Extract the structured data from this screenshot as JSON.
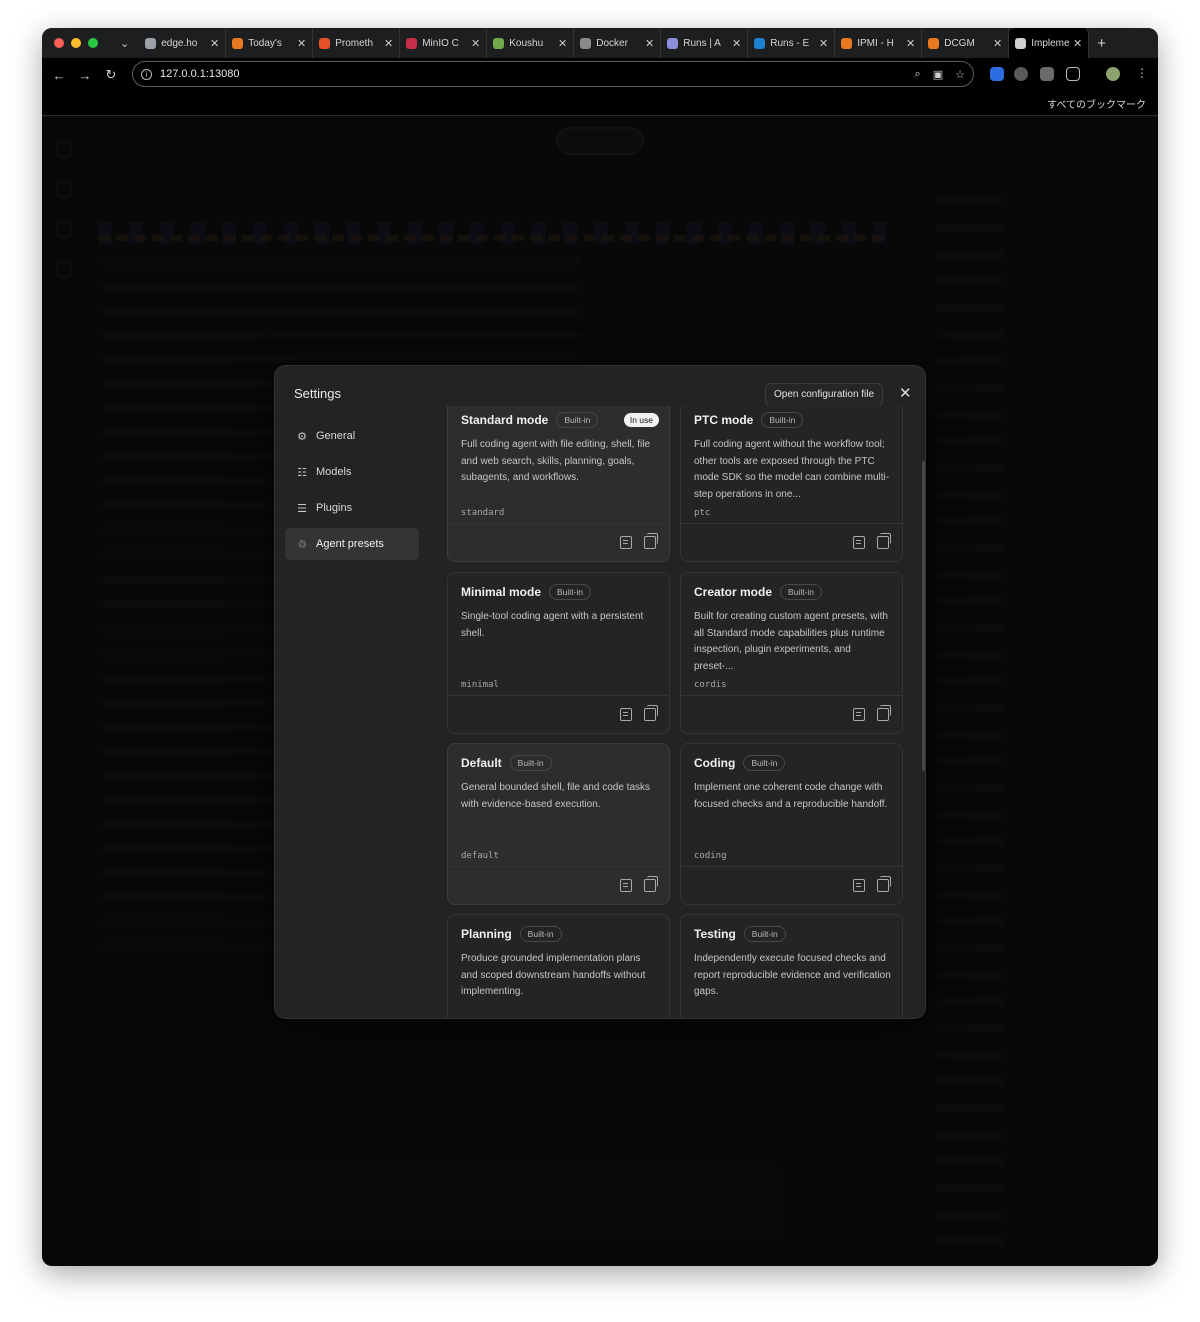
{
  "browser": {
    "tabs": [
      {
        "label": "edge.ho",
        "color": "#9aa0a6"
      },
      {
        "label": "Today's",
        "color": "#e8791f"
      },
      {
        "label": "Prometh",
        "color": "#e6522c"
      },
      {
        "label": "MinIO C",
        "color": "#c72c48"
      },
      {
        "label": "Koushu",
        "color": "#6fa84a"
      },
      {
        "label": "Docker",
        "color": "#8a8a8a"
      },
      {
        "label": "Runs | A",
        "color": "#8b8fd9"
      },
      {
        "label": "Runs - E",
        "color": "#1d7fd1"
      },
      {
        "label": "IPMI - H",
        "color": "#e8791f"
      },
      {
        "label": "DCGM",
        "color": "#e8791f"
      },
      {
        "label": "Impleme",
        "color": "#d0d0d0"
      }
    ],
    "url": "127.0.0.1:13080",
    "bookmarks_label": "すべてのブックマーク"
  },
  "modal": {
    "title": "Settings",
    "open_config_label": "Open configuration file",
    "nav": [
      {
        "label": "General",
        "icon": "gear-icon",
        "glyph": "⚙"
      },
      {
        "label": "Models",
        "icon": "database-icon",
        "glyph": "☷"
      },
      {
        "label": "Plugins",
        "icon": "sliders-icon",
        "glyph": "☰"
      },
      {
        "label": "Agent presets",
        "icon": "agents-icon",
        "glyph": "♲"
      }
    ],
    "built_in_label": "Built-in",
    "in_use_label": "In use",
    "presets": [
      {
        "name": "Standard mode",
        "id": "standard",
        "in_use": true,
        "desc": "Full coding agent with file editing, shell, file and web search, skills, planning, goals, subagents, and workflows."
      },
      {
        "name": "PTC mode",
        "id": "ptc",
        "in_use": false,
        "desc": "Full coding agent without the workflow tool; other tools are exposed through the PTC mode SDK so the model can combine multi-step operations in one..."
      },
      {
        "name": "Minimal mode",
        "id": "minimal",
        "in_use": false,
        "desc": "Single-tool coding agent with a persistent shell."
      },
      {
        "name": "Creator mode",
        "id": "cordis",
        "in_use": false,
        "desc": "Built for creating custom agent presets, with all Standard mode capabilities plus runtime inspection, plugin experiments, and preset-..."
      },
      {
        "name": "Default",
        "id": "default",
        "in_use": false,
        "desc": "General bounded shell, file and code tasks with evidence-based execution."
      },
      {
        "name": "Coding",
        "id": "coding",
        "in_use": false,
        "desc": "Implement one coherent code change with focused checks and a reproducible handoff."
      },
      {
        "name": "Planning",
        "id": "planning",
        "in_use": false,
        "desc": "Produce grounded implementation plans and scoped downstream handoffs without implementing."
      },
      {
        "name": "Testing",
        "id": "testing",
        "in_use": false,
        "desc": "Independently execute focused checks and report reproducible evidence and verification gaps."
      }
    ]
  }
}
